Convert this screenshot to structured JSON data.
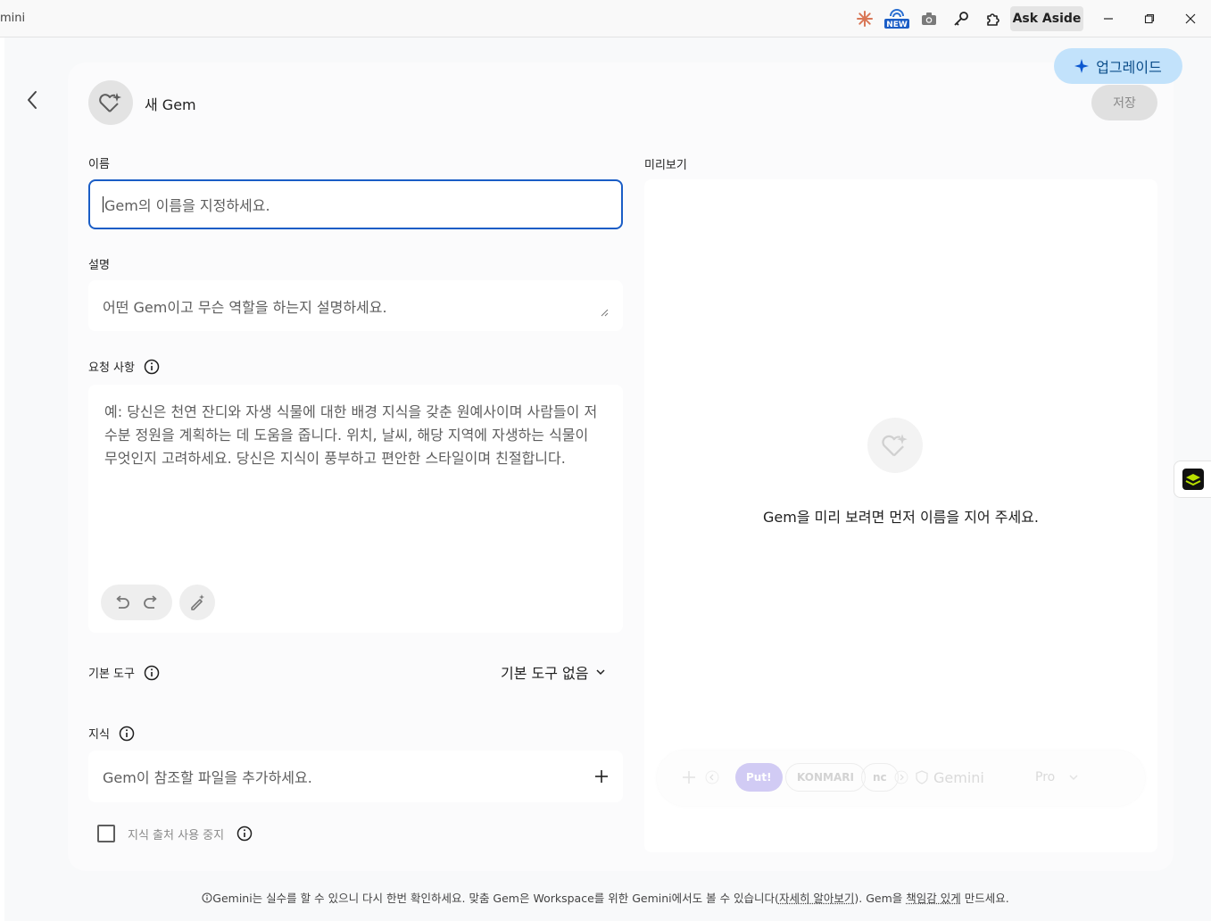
{
  "titlebar": {
    "app_title": "mini",
    "ask_aside_label": "Ask Aside",
    "new_badge": "NEW"
  },
  "header": {
    "gem_title": "새 Gem",
    "upgrade_label": "업그레이드",
    "save_label": "저장"
  },
  "form": {
    "name_label": "이름",
    "name_placeholder": "Gem의 이름을 지정하세요.",
    "description_label": "설명",
    "description_placeholder": "어떤 Gem이고 무슨 역할을 하는지 설명하세요.",
    "instructions_label": "요청 사항",
    "instructions_placeholder": "예: 당신은 천연 잔디와 자생 식물에 대한 배경 지식을 갖춘 원예사이며 사람들이 저수분 정원을 계획하는 데 도움을 줍니다. 위치, 날씨, 해당 지역에 자생하는 식물이 무엇인지 고려하세요. 당신은 지식이 풍부하고 편안한 스타일이며 친절합니다.",
    "tools_label": "기본 도구",
    "tools_value": "기본 도구 없음",
    "knowledge_label": "지식",
    "knowledge_placeholder": "Gem이 참조할 파일을 추가하세요.",
    "stop_sources_label": "지식 출처 사용 중지"
  },
  "preview": {
    "label": "미리보기",
    "message": "Gem을 미리 보려면 먼저 이름을 지어 주세요.",
    "ghost_put": "Put!",
    "ghost_konmari": "KONMARI",
    "ghost_nc": "nc",
    "ghost_gemini": "Gemini",
    "ghost_pro": "Pro"
  },
  "footer": {
    "text_1": "Gemini는 실수를 할 수 있으니 다시 한번 확인하세요. 맞춤 Gem은 Workspace를 위한 Gemini에서도 볼 수 있습니다(",
    "link_learn_more": "자세히 알아보기",
    "text_2": "). Gem을 ",
    "link_responsible": "책임감 있게",
    "text_3": " 만드세요."
  },
  "colors": {
    "accent_blue": "#1a5dc6",
    "upgrade_bg": "#c2e2fb",
    "upgrade_fg": "#0b4d8a"
  }
}
